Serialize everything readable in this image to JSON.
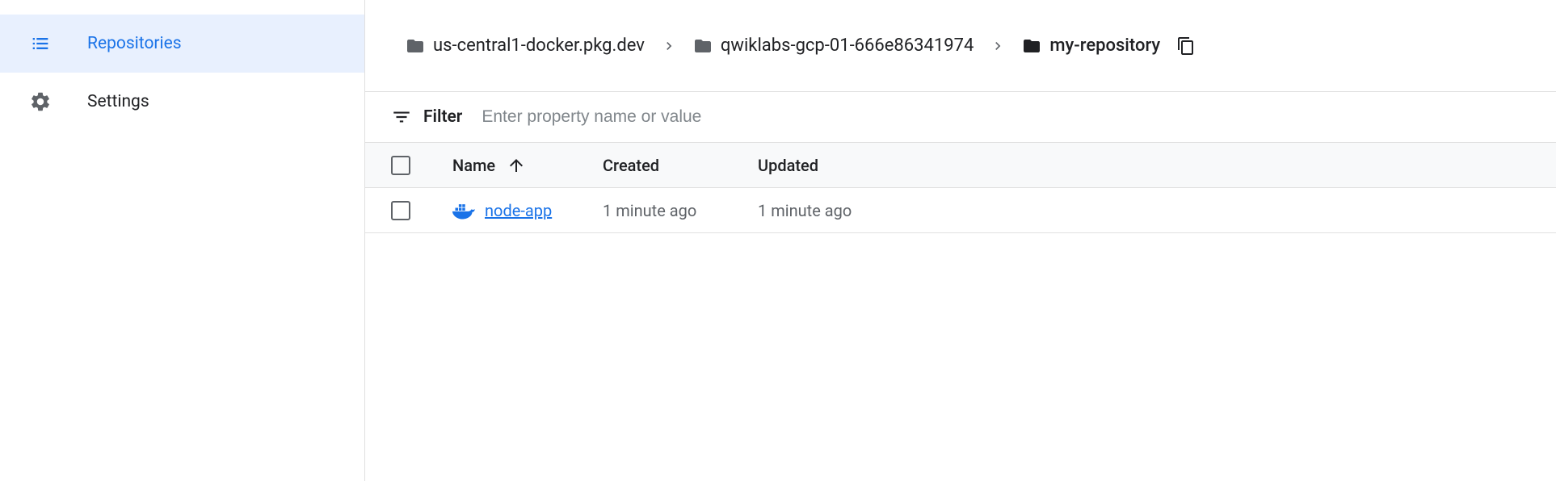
{
  "sidebar": {
    "items": [
      {
        "label": "Repositories"
      },
      {
        "label": "Settings"
      }
    ]
  },
  "breadcrumb": {
    "items": [
      {
        "label": "us-central1-docker.pkg.dev"
      },
      {
        "label": "qwiklabs-gcp-01-666e86341974"
      },
      {
        "label": "my-repository"
      }
    ]
  },
  "filter": {
    "label": "Filter",
    "placeholder": "Enter property name or value"
  },
  "table": {
    "headers": {
      "name": "Name",
      "created": "Created",
      "updated": "Updated"
    },
    "rows": [
      {
        "name": "node-app",
        "created": "1 minute ago",
        "updated": "1 minute ago"
      }
    ]
  }
}
